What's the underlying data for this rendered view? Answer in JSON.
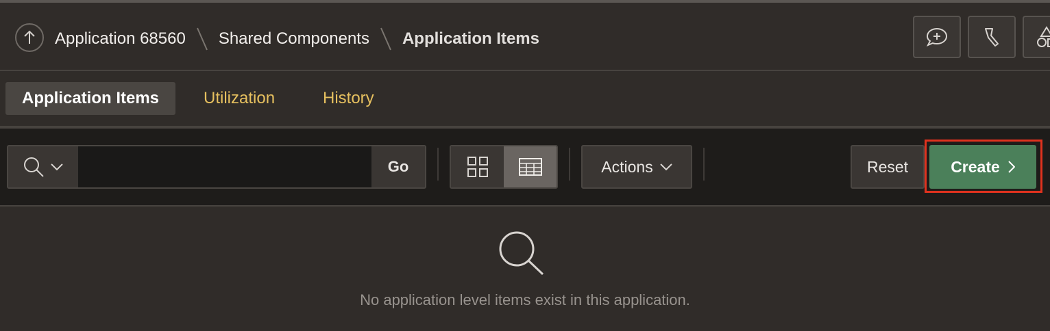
{
  "header": {
    "breadcrumbs": [
      {
        "label": "Application 68560"
      },
      {
        "label": "Shared Components"
      },
      {
        "label": "Application Items"
      }
    ],
    "up_icon": "arrow-up-circle-icon",
    "buttons": [
      {
        "icon": "add-comment-icon"
      },
      {
        "icon": "highlighter-icon"
      },
      {
        "icon": "shapes-icon"
      }
    ]
  },
  "tabs": [
    {
      "label": "Application Items",
      "active": true
    },
    {
      "label": "Utilization",
      "active": false
    },
    {
      "label": "History",
      "active": false
    }
  ],
  "toolbar": {
    "search": {
      "value": "",
      "placeholder": "",
      "menu_icon": "search-icon"
    },
    "go_label": "Go",
    "views": [
      {
        "icon": "grid-view-icon",
        "selected": false
      },
      {
        "icon": "report-view-icon",
        "selected": true
      }
    ],
    "actions_label": "Actions",
    "reset_label": "Reset",
    "create_label": "Create"
  },
  "empty_state": {
    "icon": "search-icon",
    "message": "No application level items exist in this application."
  },
  "colors": {
    "background": "#302c29",
    "toolbar": "#1e1c1a",
    "tab_link": "#e6c05f",
    "create_button": "#4b805a",
    "highlight_outline": "#e0321e"
  }
}
